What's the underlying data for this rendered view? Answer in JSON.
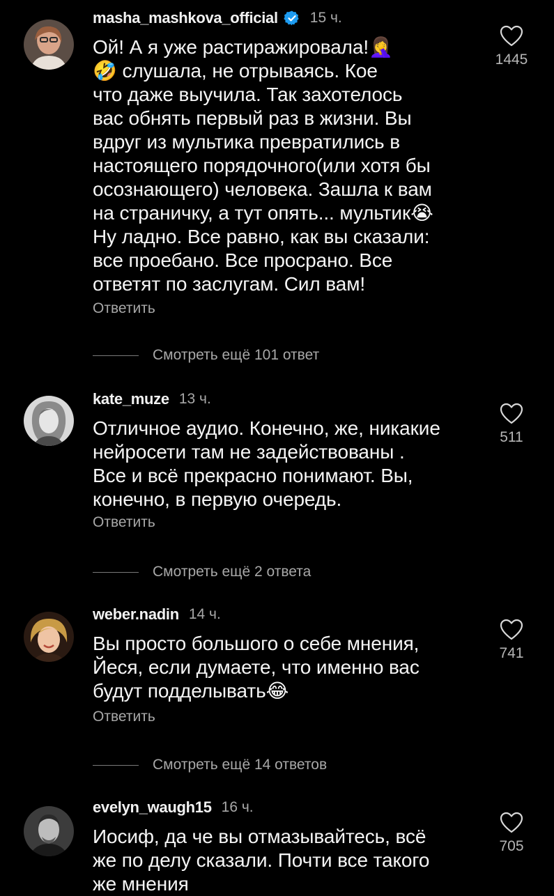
{
  "colors": {
    "background": "#000000",
    "text_primary": "#f5f5f5",
    "text_secondary": "#a8a8a8",
    "verified_badge": "#1d9bf0"
  },
  "comments": [
    {
      "username": "masha_mashkova_official",
      "verified": true,
      "time": "15 ч.",
      "text": "Ой! А я уже растиражировала!🤦‍♀️\n🤣 слушала, не отрываясь. Кое\nчто даже выучила. Так захотелось\nвас обнять первый раз в жизни. Вы\nвдруг из мультика превратились в\nнастоящего порядочного(или хотя бы\nосознающего) человека. Зашла к вам\nна страничку, а тут опять... мультик😭\nНу ладно. Все равно, как вы сказали:\nвсе проебано. Все просрано. Все\nответят по заслугам. Сил вам!",
      "reply_label": "Ответить",
      "like_icon": "heart-outline-icon",
      "like_count": "1445",
      "more_replies": "Смотреть ещё 101 ответ"
    },
    {
      "username": "kate_muze",
      "verified": false,
      "time": "13 ч.",
      "text": "Отличное аудио. Конечно, же, никакие\nнейросети там не задействованы .\nВсе и всё прекрасно понимают. Вы,\nконечно, в первую очередь.",
      "reply_label": "Ответить",
      "like_icon": "heart-outline-icon",
      "like_count": "511",
      "more_replies": "Смотреть ещё 2 ответа"
    },
    {
      "username": "weber.nadin",
      "verified": false,
      "time": "14 ч.",
      "text": "Вы просто большого о себе мнения,\nЙеся, если думаете, что именно вас\nбудут подделывать😂",
      "reply_label": "Ответить",
      "like_icon": "heart-outline-icon",
      "like_count": "741",
      "more_replies": "Смотреть ещё 14 ответов"
    },
    {
      "username": "evelyn_waugh15",
      "verified": false,
      "time": "16 ч.",
      "text": "Иосиф, да че вы отмазывайтесь, всё\nже по делу сказали. Почти все такого\nже мнения",
      "like_icon": "heart-outline-icon",
      "like_count": "705"
    }
  ]
}
